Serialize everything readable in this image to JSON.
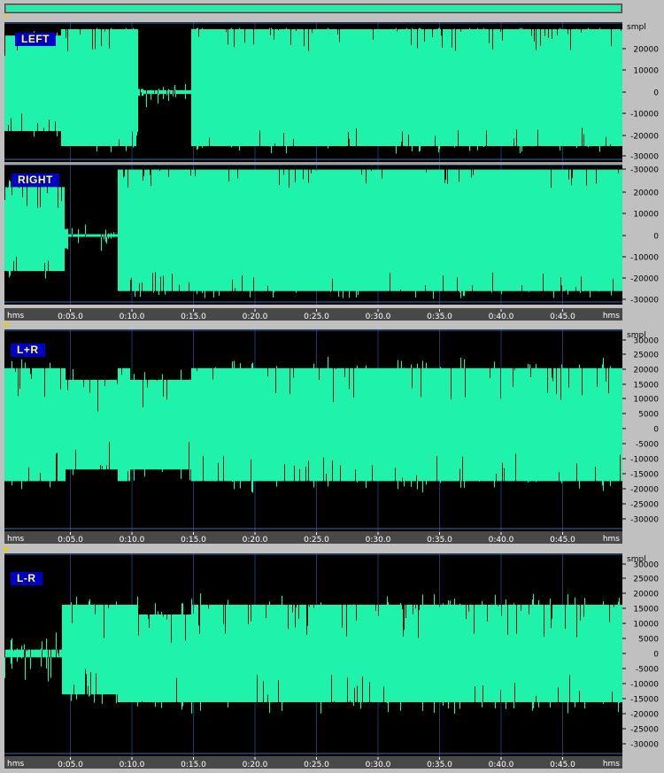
{
  "colors": {
    "waveform": "#1ff2aa",
    "background": "#000000",
    "grid": "#1c3a6c",
    "ruler_bg": "#484848",
    "ruler_text": "#ffffff",
    "label_bg": "#0000c8",
    "label_text": "#ffff60"
  },
  "scrollbar": {
    "icon": "horizontal-scrollbar"
  },
  "time_ruler": {
    "unit_left": "hms",
    "unit_right": "hms",
    "ticks": [
      "0:05.0",
      "0:10.0",
      "0:15.0",
      "0:20.0",
      "0:25.0",
      "0:30.0",
      "0:35.0",
      "0:40.0",
      "0:45.0"
    ]
  },
  "panels": [
    {
      "id": "stereo",
      "channels": [
        {
          "label": "LEFT",
          "amp_unit": "smpl",
          "amp_labels": [
            "20000",
            "10000",
            "0",
            "-10000",
            "-20000",
            "-30000"
          ]
        },
        {
          "label": "RIGHT",
          "amp_unit": "",
          "amp_labels": [
            "-30000",
            "20000",
            "10000",
            "0",
            "-10000",
            "-20000",
            "-30000"
          ]
        }
      ]
    },
    {
      "id": "sum",
      "channels": [
        {
          "label": "L+R",
          "amp_unit": "smpl",
          "amp_labels": [
            "30000",
            "25000",
            "20000",
            "15000",
            "10000",
            "5000",
            "0",
            "-5000",
            "-10000",
            "-15000",
            "-20000",
            "-25000",
            "-30000"
          ]
        }
      ]
    },
    {
      "id": "difference",
      "channels": [
        {
          "label": "L-R",
          "amp_unit": "smpl",
          "amp_labels": [
            "30000",
            "25000",
            "20000",
            "15000",
            "10000",
            "5000",
            "0",
            "-5000",
            "-10000",
            "-15000",
            "-20000",
            "-25000",
            "-30000"
          ]
        }
      ]
    }
  ]
}
